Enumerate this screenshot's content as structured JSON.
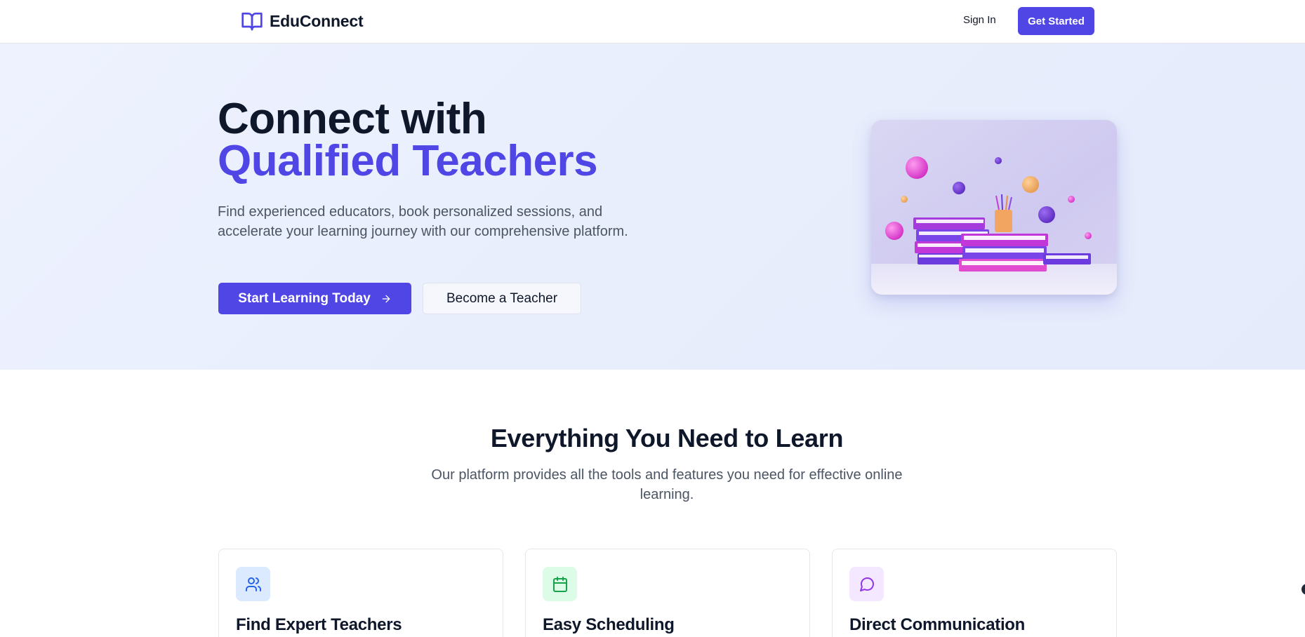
{
  "header": {
    "brand": "EduConnect",
    "brand_icon": "book-open-icon",
    "sign_in": "Sign In",
    "get_started": "Get Started"
  },
  "hero": {
    "title_line1": "Connect with",
    "title_line2": "Qualified Teachers",
    "description": "Find experienced educators, book personalized sessions, and accelerate your learning journey with our comprehensive platform.",
    "primary_button": "Start Learning Today",
    "primary_button_icon": "arrow-right-icon",
    "secondary_button": "Become a Teacher",
    "image_icon": "books-illustration"
  },
  "features": {
    "title": "Everything You Need to Learn",
    "subtitle": "Our platform provides all the tools and features you need for effective online learning.",
    "cards": [
      {
        "title": "Find Expert Teachers",
        "icon": "users-icon",
        "icon_color": "#2563eb",
        "icon_bg": "#dbeafe"
      },
      {
        "title": "Easy Scheduling",
        "icon": "calendar-icon",
        "icon_color": "#16a34a",
        "icon_bg": "#dcfce7"
      },
      {
        "title": "Direct Communication",
        "icon": "message-circle-icon",
        "icon_color": "#9333ea",
        "icon_bg": "#f3e8ff"
      }
    ]
  },
  "colors": {
    "accent": "#4f46e5",
    "text_dark": "#0f172a",
    "text_muted": "#4b5563"
  }
}
